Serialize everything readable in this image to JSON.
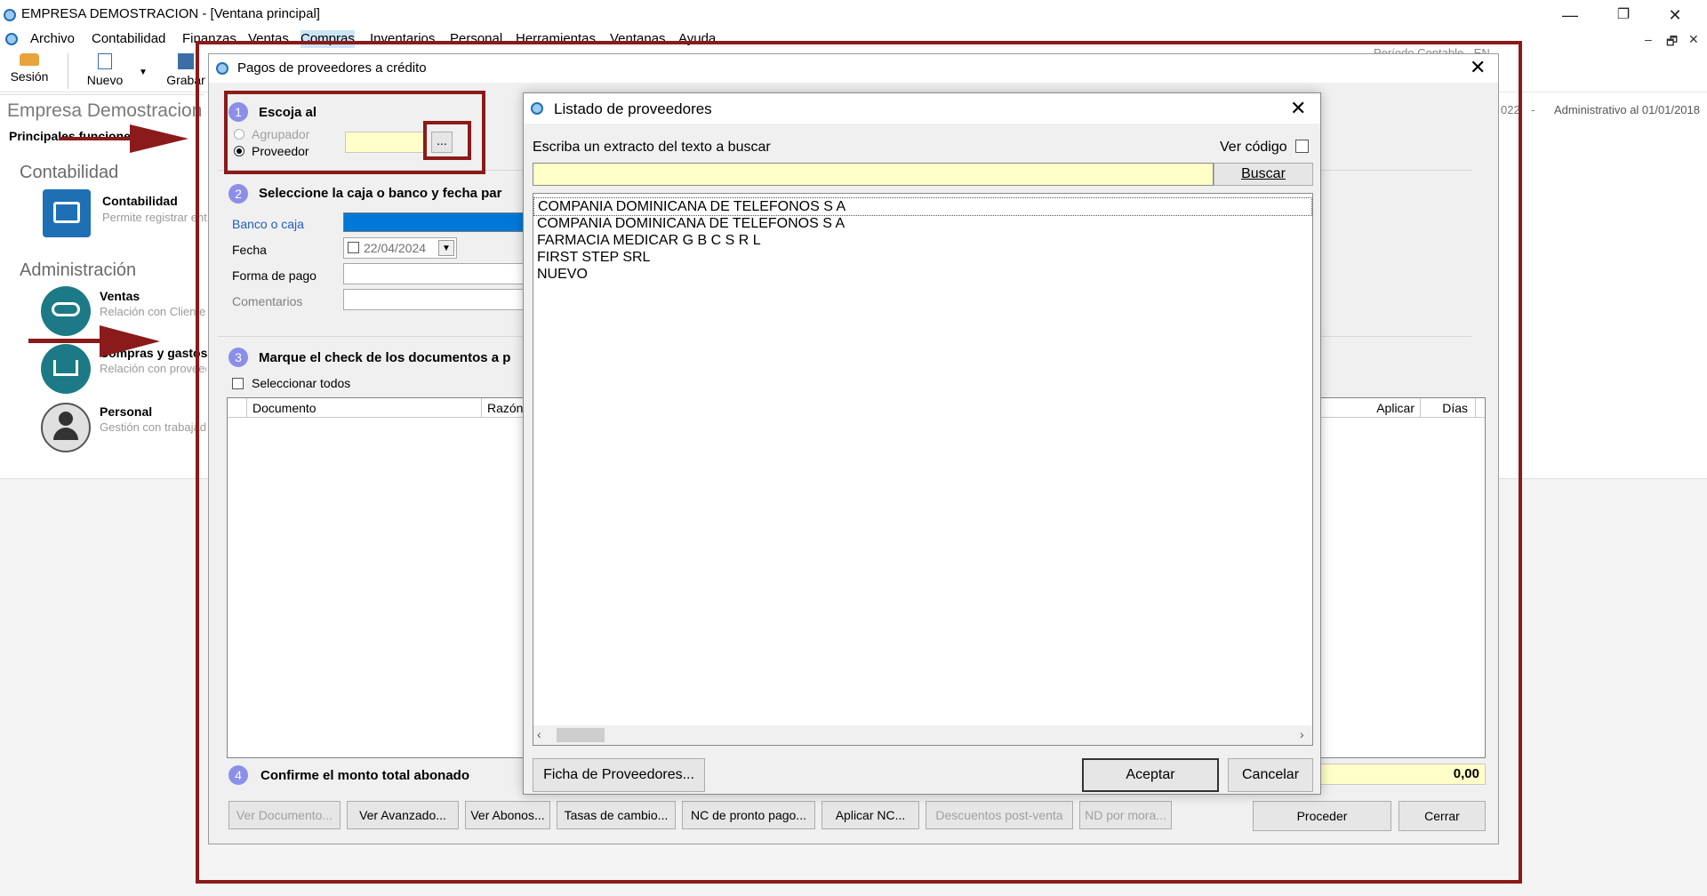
{
  "window": {
    "title": "EMPRESA DEMOSTRACION - [Ventana principal]",
    "controls": [
      "—",
      "❐",
      "✕"
    ],
    "mdi_controls": [
      "–",
      "🗗",
      "✕"
    ]
  },
  "menu": [
    "Archivo",
    "Contabilidad",
    "Finanzas",
    "Ventas",
    "Compras",
    "Inventarios",
    "Personal",
    "Herramientas",
    "Ventanas",
    "Ayuda"
  ],
  "toolbar": {
    "sesion": "Sesión",
    "nuevo": "Nuevo",
    "grabar": "Grabar",
    "period_label": "Período Contable - EN"
  },
  "home": {
    "company": "Empresa Demostracion",
    "subheading": "Principales funciones",
    "status_period": "022",
    "status_admin": "Administrativo al 01/01/2018",
    "sections": {
      "contabilidad": "Contabilidad",
      "administracion": "Administración"
    },
    "modules": [
      {
        "title": "Contabilidad",
        "desc": "Permite registrar entradas"
      },
      {
        "title": "Ventas",
        "desc": "Relación con Clientes"
      },
      {
        "title": "Compras y gastos",
        "desc": "Relación con proveedores"
      },
      {
        "title": "Personal",
        "desc": "Gestión con trabajadores"
      }
    ]
  },
  "dialog_pagos": {
    "title": "Pagos de proveedores a crédito",
    "step1": {
      "num": "1",
      "title": "Escoja al",
      "opt_agrupador": "Agrupador",
      "opt_proveedor": "Proveedor",
      "browse": "..."
    },
    "step2": {
      "num": "2",
      "title": "Seleccione la caja o banco y fecha par",
      "banco_label": "Banco o caja",
      "fecha_label": "Fecha",
      "fecha_value": "22/04/2024",
      "forma_label": "Forma de pago",
      "comentarios_label": "Comentarios"
    },
    "step3": {
      "num": "3",
      "title": "Marque el check de los documentos a p",
      "select_all": "Seleccionar todos",
      "columns": [
        "Documento",
        "Razón",
        "Aplicar",
        "Días"
      ]
    },
    "step4": {
      "num": "4",
      "title": "Confirme el monto total abonado",
      "total": "0,00"
    },
    "buttons": {
      "ver_documento": "Ver Documento...",
      "ver_avanzado": "Ver Avanzado...",
      "ver_abonos": "Ver Abonos...",
      "tasas": "Tasas de cambio...",
      "nc_pronto": "NC de pronto pago...",
      "aplicar_nc": "Aplicar NC...",
      "descuentos": "Descuentos post-venta",
      "nd_mora": "ND por mora...",
      "proceder": "Proceder",
      "cerrar": "Cerrar"
    }
  },
  "dialog_listado": {
    "title": "Listado de proveedores",
    "search_label": "Escriba un extracto del texto a buscar",
    "ver_codigo": "Ver código",
    "search_value": "",
    "buscar": "Buscar",
    "items": [
      "COMPANIA DOMINICANA DE TELEFONOS S A",
      "COMPANIA DOMINICANA DE TELEFONOS S A",
      "FARMACIA MEDICAR G B C S R L",
      "FIRST STEP SRL",
      "NUEVO"
    ],
    "ficha": "Ficha de Proveedores...",
    "aceptar": "Aceptar",
    "cancelar": "Cancelar"
  },
  "colors": {
    "annotation_red": "#8b1a1a",
    "highlight_yellow": "#ffffc8",
    "step_purple": "#8b8fe8",
    "selection_blue": "#0078d7"
  }
}
